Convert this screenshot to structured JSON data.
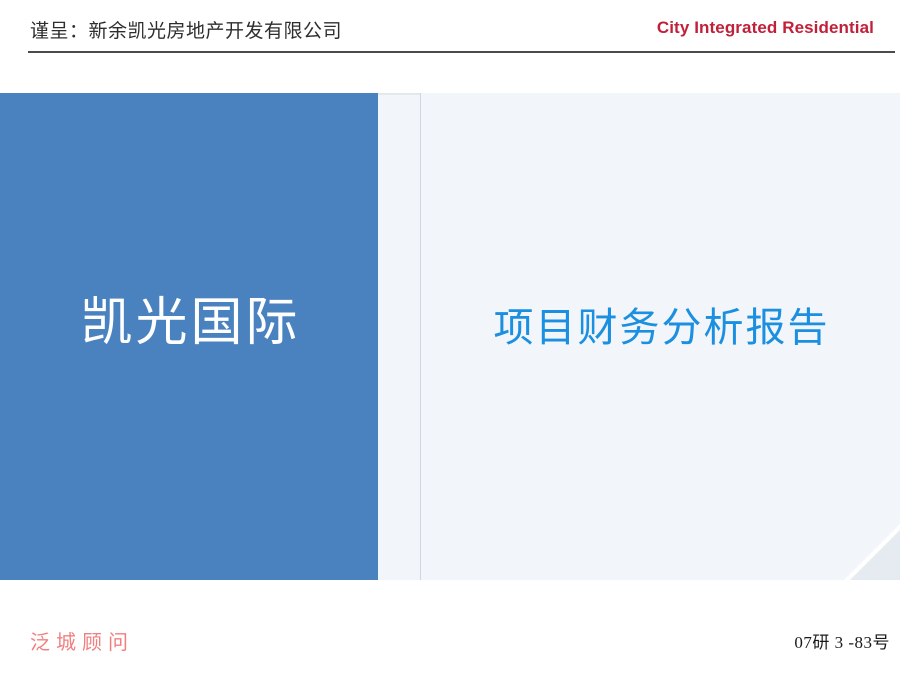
{
  "header": {
    "recipient_label": "谨呈：新余凯光房地产开发有限公司",
    "brand_en": "City Integrated Residential",
    "rule_color": "#4a4a4a",
    "brand_color": "#c0213a"
  },
  "card": {
    "background": "#f2f5f9",
    "blue_panel": {
      "title": "凯光国际",
      "background": "#4a82c0",
      "text_color": "#ffffff"
    },
    "right_panel": {
      "title": "项目财务分析报告",
      "text_color": "#1b8fe0",
      "background": "#f2f5f9"
    },
    "divider_color": "#c9d7e6",
    "fold_color": "#e6eaf1"
  },
  "footer": {
    "consultant": "泛城顾问",
    "consultant_color": "#f08080",
    "doc_number": "07研 3 -83号"
  }
}
